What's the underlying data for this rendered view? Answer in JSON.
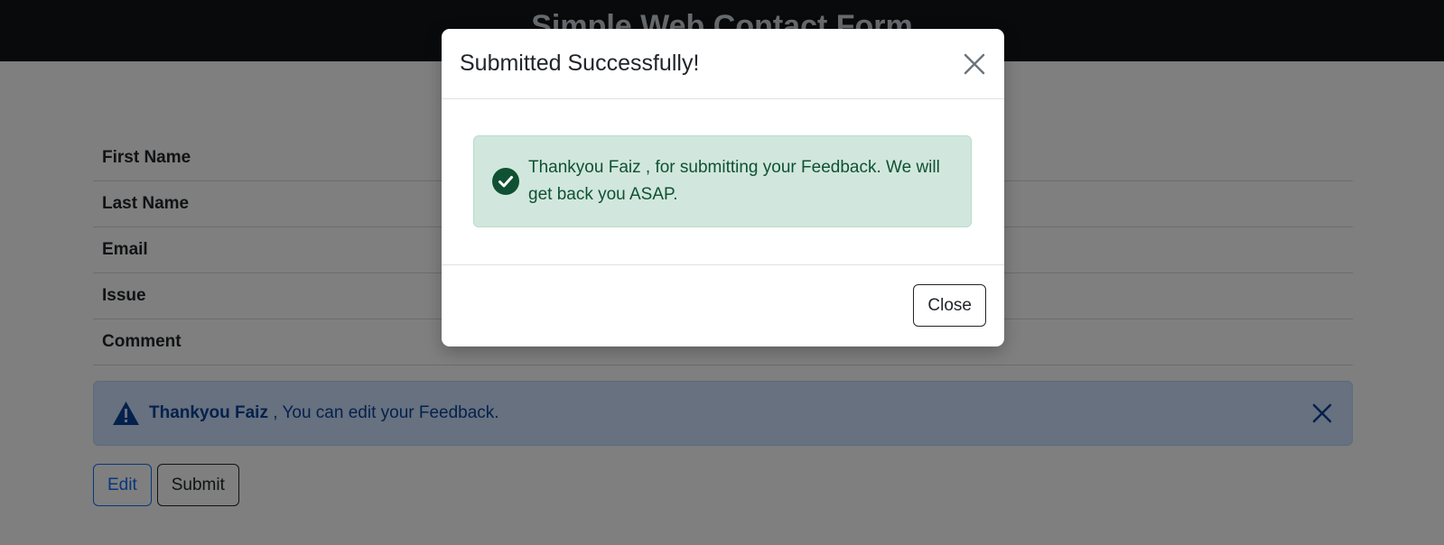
{
  "header": {
    "title": "Simple Web Contact Form"
  },
  "details": {
    "rows": [
      {
        "label": "First Name",
        "value": ""
      },
      {
        "label": "Last Name",
        "value": ""
      },
      {
        "label": "Email",
        "value": ""
      },
      {
        "label": "Issue",
        "value": ""
      },
      {
        "label": "Comment",
        "value": ""
      }
    ]
  },
  "info_alert": {
    "strong": "Thankyou Faiz",
    "text": " , You can edit your Feedback.",
    "icon": "warning-triangle-icon",
    "close_icon": "close-icon"
  },
  "actions": {
    "edit_label": "Edit",
    "submit_label": "Submit"
  },
  "modal": {
    "title": "Submitted Successfully!",
    "message": "Thankyou Faiz , for submitting your Feedback. We will get back you ASAP.",
    "close_label": "Close",
    "icon": "check-circle-icon"
  },
  "colors": {
    "header_bg": "#111418",
    "info_alert_bg": "#cfe2ff",
    "info_alert_text": "#084298",
    "success_alert_bg": "#d1e7dd",
    "success_alert_text": "#0f5132",
    "edit_button": "#0d6efd"
  }
}
